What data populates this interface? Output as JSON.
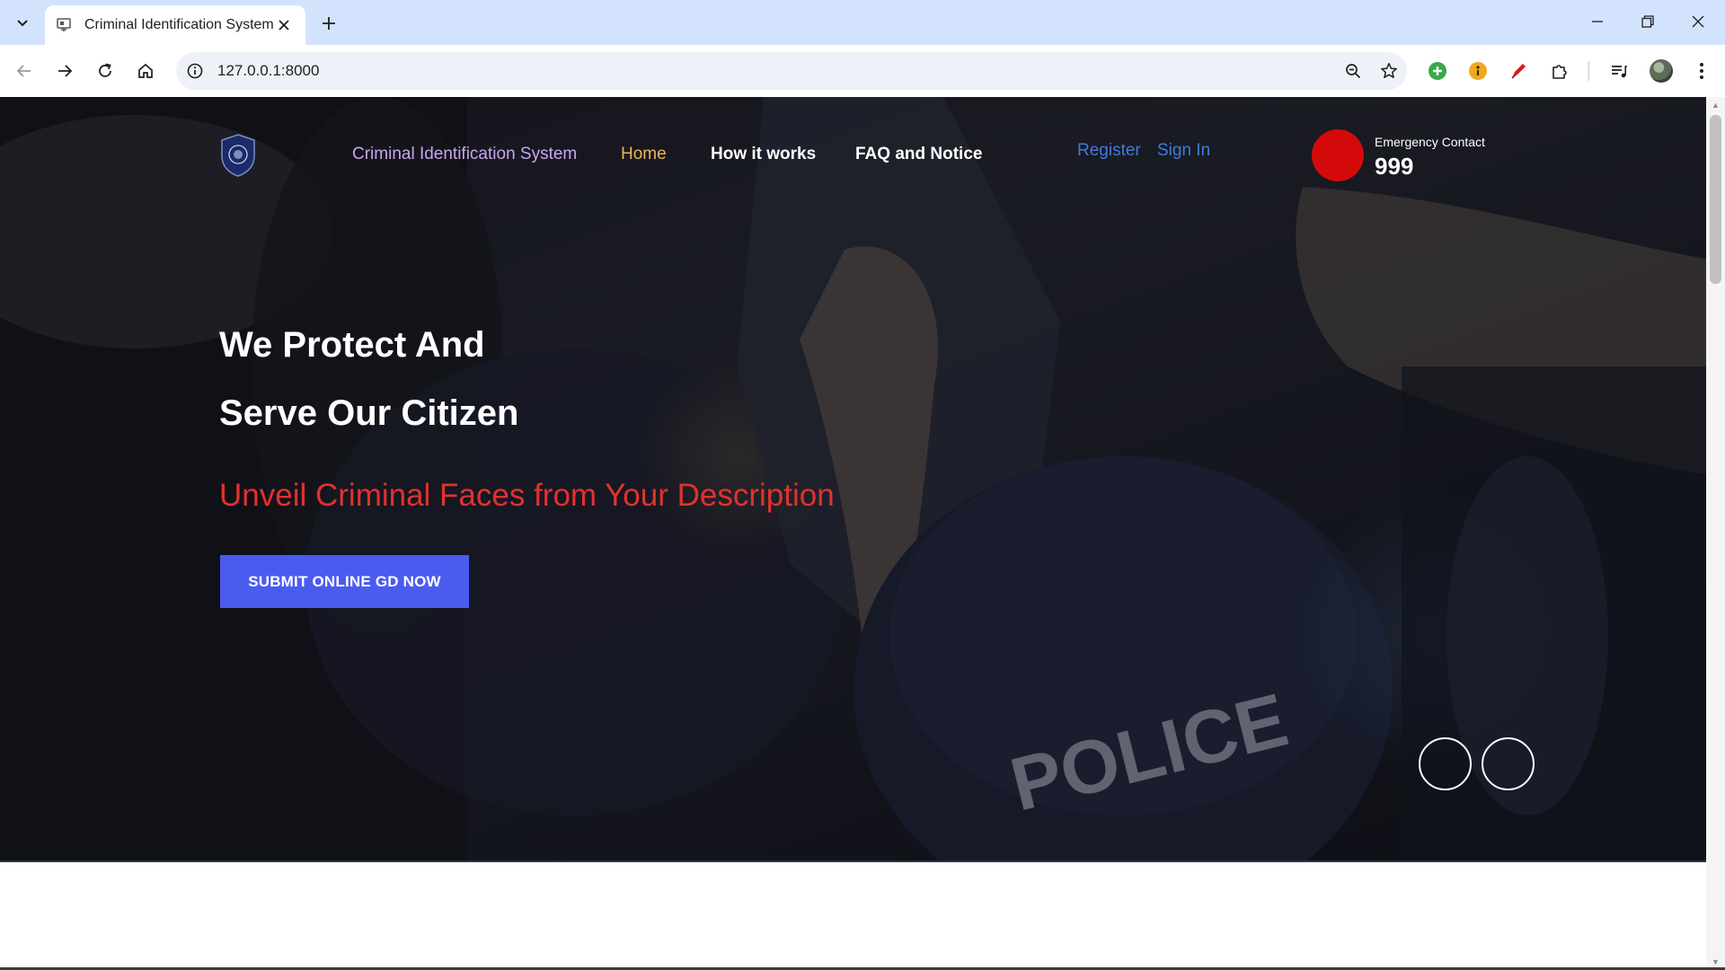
{
  "browser": {
    "tab_title": "Criminal Identification System",
    "url": "127.0.0.1:8000",
    "icons": [
      "tab-list-icon",
      "favicon-icon",
      "close-icon",
      "plus-icon",
      "minimize-icon",
      "restore-icon",
      "window-close-icon",
      "back-icon",
      "forward-icon",
      "reload-icon",
      "home-icon",
      "info-icon",
      "zoom-icon",
      "star-icon",
      "extension-green-icon",
      "extension-yellow-icon",
      "extension-pen-icon",
      "puzzle-icon",
      "media-icon",
      "avatar",
      "more-icon"
    ]
  },
  "site": {
    "brand": "Criminal Identification System",
    "nav": {
      "home": "Home",
      "how": "How it works",
      "faq": "FAQ and Notice"
    },
    "auth": {
      "register": "Register",
      "signin": "Sign In"
    },
    "emergency": {
      "label": "Emergency Contact",
      "number": "999"
    }
  },
  "hero": {
    "headline_line1": "We Protect And",
    "headline_line2": "Serve Our Citizen",
    "subheadline": "Unveil Criminal Faces from Your Description",
    "cta": "SUBMIT ONLINE GD NOW",
    "photo_text": "POLICE"
  },
  "colors": {
    "brand": "#c9a6f0",
    "nav_active": "#e9b75b",
    "auth_link": "#3f7bdc",
    "subheadline": "#e0322f",
    "cta_bg": "#4a5cf0",
    "emergency": "#d40a0a"
  }
}
